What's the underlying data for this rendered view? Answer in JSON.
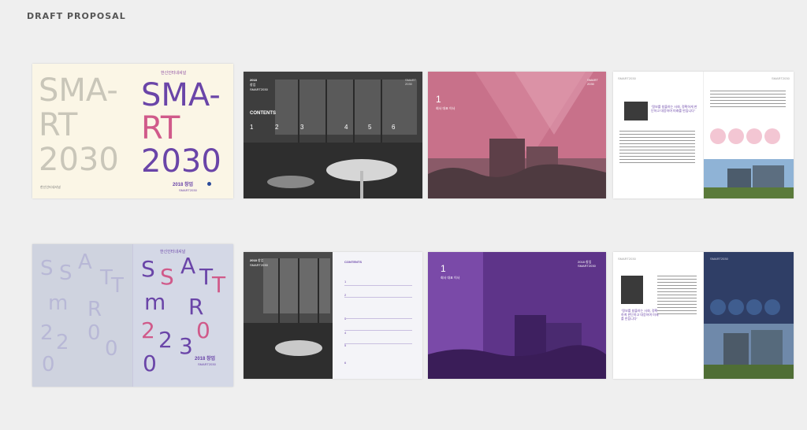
{
  "page": {
    "title": "DRAFT PROPOSAL"
  },
  "covers": {
    "v1": {
      "brand": "한신인터내셔널",
      "big_lines": [
        "SMA-",
        "RT",
        "2030"
      ],
      "year_title": "2018 창업",
      "subtitle": "SMART2030"
    },
    "v2": {
      "brand": "한신인터내셔널",
      "letters": [
        "S",
        "S",
        "A",
        "T",
        "T",
        "m",
        "R",
        "r",
        "2",
        "2",
        "3",
        "0",
        "0",
        "0",
        "0",
        "0"
      ],
      "year_title": "2018 창업",
      "subtitle": "SMART2030"
    }
  },
  "contents_v1": {
    "header_year": "2018",
    "header_title": "창업",
    "header_sub": "SMART2030",
    "label": "CONTENTS",
    "numbers": [
      "1",
      "2",
      "3",
      "4",
      "5",
      "6"
    ],
    "right_mark": "SMART\n2030"
  },
  "contents_v2": {
    "header_year": "2018",
    "header_title": "창업",
    "header_sub": "SMART2030",
    "label": "CONTENTS",
    "items": [
      "1",
      "2",
      "3",
      "4",
      "5",
      "6"
    ]
  },
  "chapter_v1": {
    "number": "1",
    "title": "회사 대표 이사",
    "right_mark": "SMART\n2030"
  },
  "chapter_v2": {
    "number": "1",
    "title": "회사 대표 이사",
    "right_mark": "2018 창업\nSMART2030"
  },
  "interview_v1": {
    "quote": "\"정보를 창출하는 사회, 정확하게 판단하고 대응하여 미래를 만듭니다\""
  },
  "interview_v2": {
    "quote": "\"정보를 창출하는 사회, 정확하게 판단하고 대응하여 미래를 만듭니다\""
  },
  "colors": {
    "cream": "#fbf6e6",
    "pink": "#c8718a",
    "purple": "#6b3d99",
    "lavender": "#c9c9de",
    "grey_photo": "#5a5a5a"
  }
}
